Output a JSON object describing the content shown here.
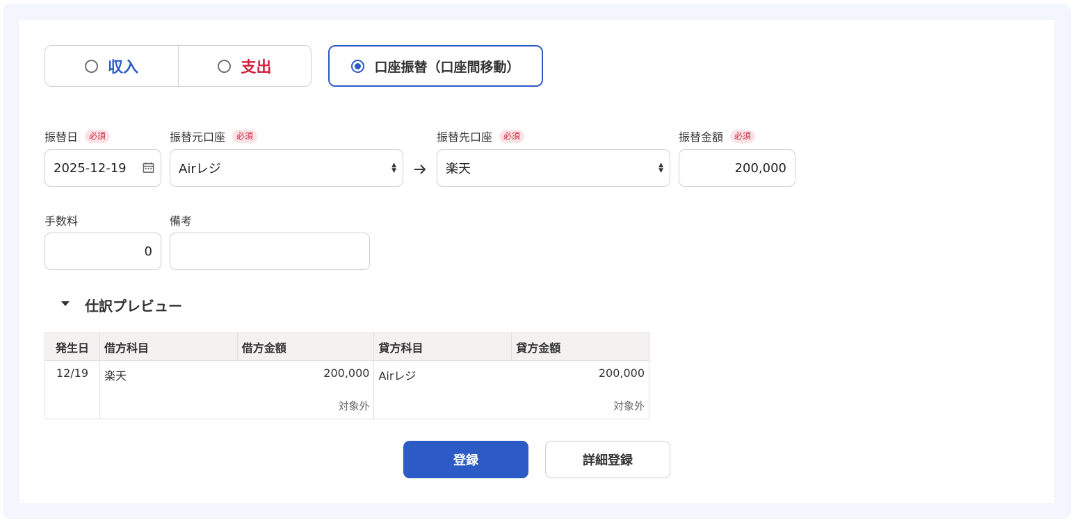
{
  "type_toggle": {
    "income_label": "収入",
    "expense_label": "支出",
    "transfer_label": "口座振替（口座間移動）",
    "selected": "transfer"
  },
  "form": {
    "required_badge": "必須",
    "date": {
      "label": "振替日",
      "value": "2025-12-19"
    },
    "from_account": {
      "label": "振替元口座",
      "value": "Airレジ"
    },
    "to_account": {
      "label": "振替先口座",
      "value": "楽天"
    },
    "amount": {
      "label": "振替金額",
      "value": "200,000"
    },
    "fee": {
      "label": "手数料",
      "value": "0"
    },
    "memo": {
      "label": "備考",
      "value": ""
    }
  },
  "preview": {
    "title": "仕訳プレビュー",
    "headers": [
      "発生日",
      "借方科目",
      "借方金額",
      "貸方科目",
      "貸方金額"
    ],
    "row": {
      "date": "12/19",
      "debit_account": "楽天",
      "debit_amount": "200,000",
      "debit_tax": "対象外",
      "credit_account": "Airレジ",
      "credit_amount": "200,000",
      "credit_tax": "対象外"
    }
  },
  "actions": {
    "register": "登録",
    "detail_register": "詳細登録"
  },
  "colors": {
    "accent": "#2d5bc6",
    "income": "#2d5bc6",
    "expense": "#d21d3c",
    "required_bg": "#fde2e6"
  }
}
